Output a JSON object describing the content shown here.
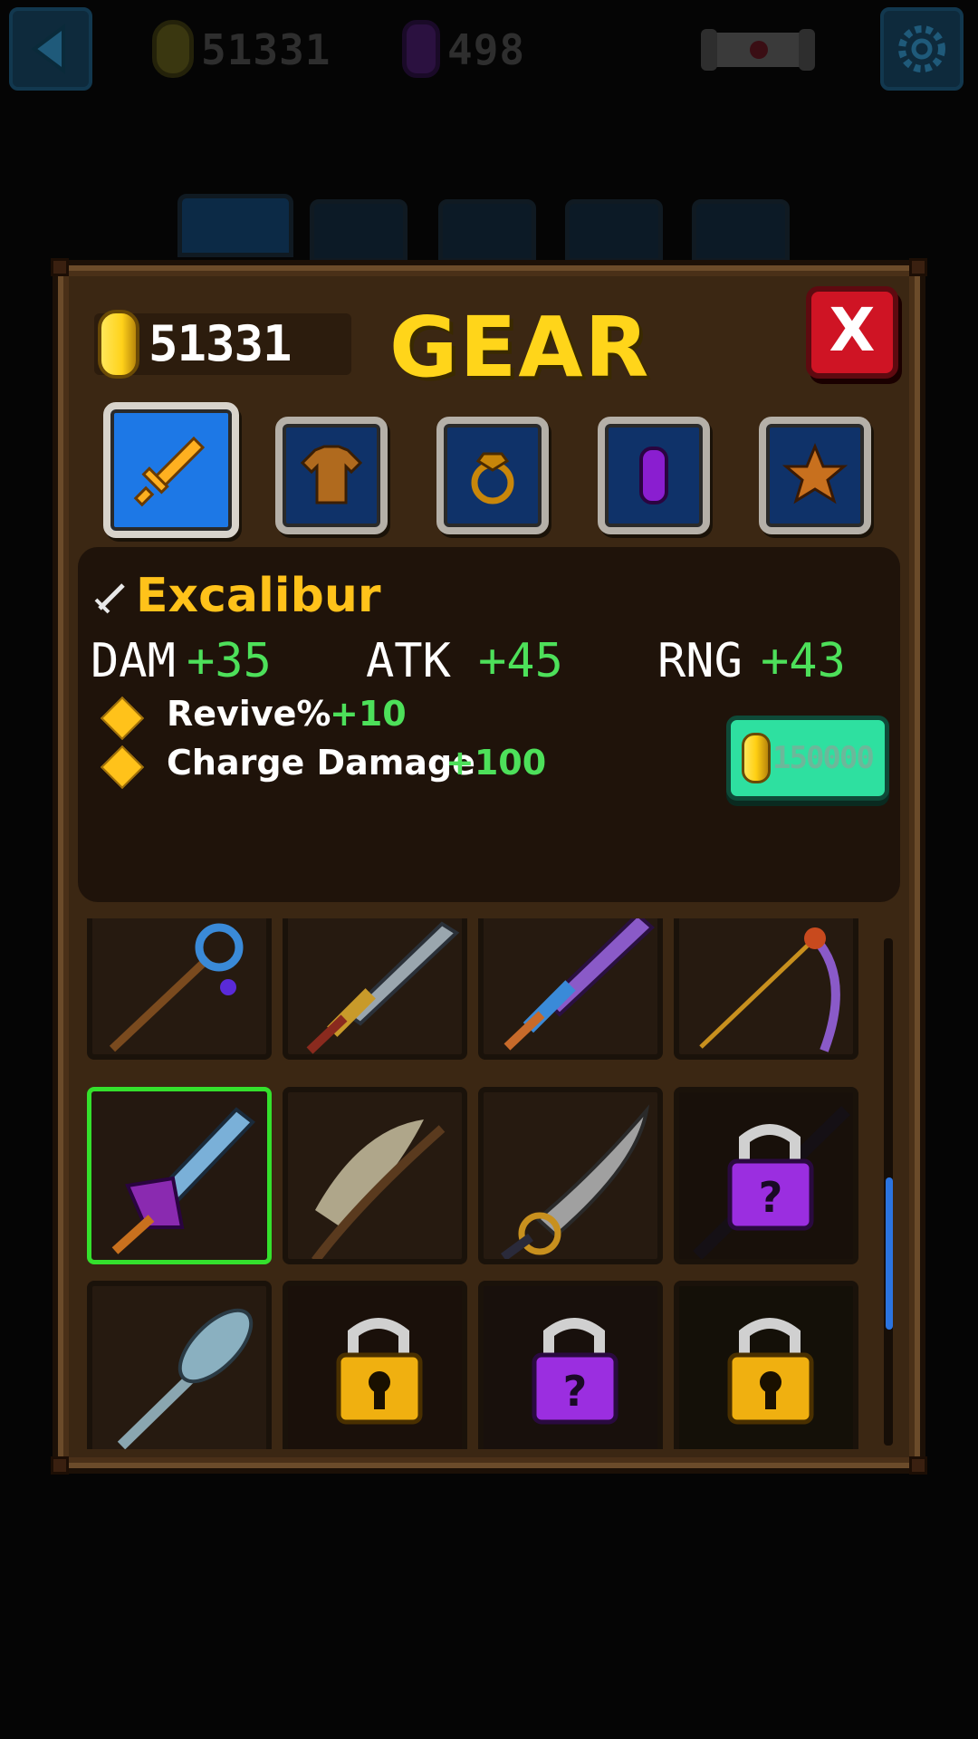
{
  "hud": {
    "gold": "51331",
    "gems": "498"
  },
  "panel": {
    "gold": "51331",
    "title": "GEAR",
    "close_label": "X",
    "tabs": [
      {
        "name": "weapon",
        "icon": "sword-icon",
        "active": true
      },
      {
        "name": "armor",
        "icon": "shirt-icon",
        "active": false
      },
      {
        "name": "ring",
        "icon": "ring-icon",
        "active": false
      },
      {
        "name": "gem",
        "icon": "gem-icon",
        "active": false
      },
      {
        "name": "star",
        "icon": "star-icon",
        "active": false
      }
    ]
  },
  "item": {
    "name": "Excalibur",
    "stats": [
      {
        "label": "DAM",
        "value": "+35"
      },
      {
        "label": "ATK",
        "value": "+45"
      },
      {
        "label": "RNG",
        "value": "+43"
      }
    ],
    "bonuses": [
      {
        "label": "Revive%",
        "value": "+10"
      },
      {
        "label": "Charge Damage",
        "value": "+100"
      }
    ],
    "price": "150000"
  },
  "grid": {
    "rows": [
      [
        {
          "icon": "staff-icon",
          "state": "owned"
        },
        {
          "icon": "broadsword-icon",
          "state": "owned"
        },
        {
          "icon": "ornate-sword-icon",
          "state": "owned"
        },
        {
          "icon": "scythe-icon",
          "state": "owned"
        }
      ],
      [
        {
          "icon": "excalibur-icon",
          "state": "selected"
        },
        {
          "icon": "flame-staff-icon",
          "state": "owned"
        },
        {
          "icon": "scimitar-icon",
          "state": "owned"
        },
        {
          "icon": "mystery-lock-icon",
          "state": "locked-mystery"
        }
      ],
      [
        {
          "icon": "club-icon",
          "state": "owned"
        },
        {
          "icon": "keyhole-lock-icon",
          "state": "locked-gold"
        },
        {
          "icon": "mystery-lock-icon",
          "state": "locked-mystery"
        },
        {
          "icon": "keyhole-lock-icon",
          "state": "locked-gold"
        }
      ]
    ]
  },
  "colors": {
    "accent_gold": "#ffd51a",
    "stat_green": "#4de05a",
    "close_red": "#cf1424",
    "buy_teal": "#2ee0a0",
    "tab_blue": "#1d78e6",
    "selected_green": "#34e02c"
  }
}
